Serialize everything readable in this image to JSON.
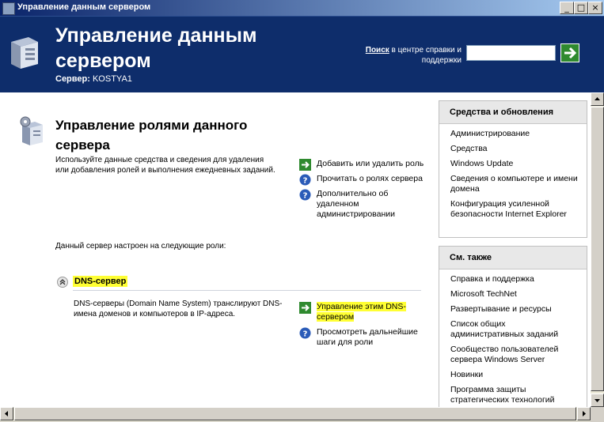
{
  "window": {
    "title": "Управление данным сервером"
  },
  "header": {
    "title": "Управление данным сервером",
    "server_label": "Сервер:",
    "server_name": "KOSTYA1",
    "search_bold": "Поиск",
    "search_rest": " в центре справки и поддержки",
    "search_value": ""
  },
  "main": {
    "title": "Управление ролями данного сервера",
    "description": "Используйте данные средства и сведения для удаления или добавления ролей и выполнения ежедневных заданий.",
    "configured_text": "Данный сервер настроен на следующие роли:",
    "actions": [
      {
        "label": "Добавить или удалить роль"
      },
      {
        "label": "Прочитать о ролях сервера"
      },
      {
        "label": "Дополнительно об удаленном администрировании"
      }
    ],
    "role": {
      "name": "DNS-сервер",
      "description": "DNS-серверы (Domain Name System) транслируют DNS-имена доменов и компьютеров в IP-адреса.",
      "actions": [
        {
          "label": "Управление этим DNS-сервером"
        },
        {
          "label": "Просмотреть дальнейшие шаги для роли"
        }
      ]
    }
  },
  "tools_panel": {
    "title": "Средства и обновления",
    "links": [
      "Администрирование",
      "Средства",
      "Windows Update",
      "Сведения о компьютере и имени домена",
      "Конфигурация усиленной безопасности Internet Explorer"
    ]
  },
  "see_also_panel": {
    "title": "См. также",
    "links": [
      "Справка и поддержка",
      "Microsoft TechNet",
      "Развертывание и ресурсы",
      "Список общих административных заданий",
      "Сообщество пользователей сервера Windows Server",
      "Новинки",
      "Программа защиты стратегических технологий"
    ]
  },
  "colors": {
    "header_bg": "#0e2d6b",
    "highlight": "#ffff33",
    "accent_green": "#2f8a2f"
  }
}
